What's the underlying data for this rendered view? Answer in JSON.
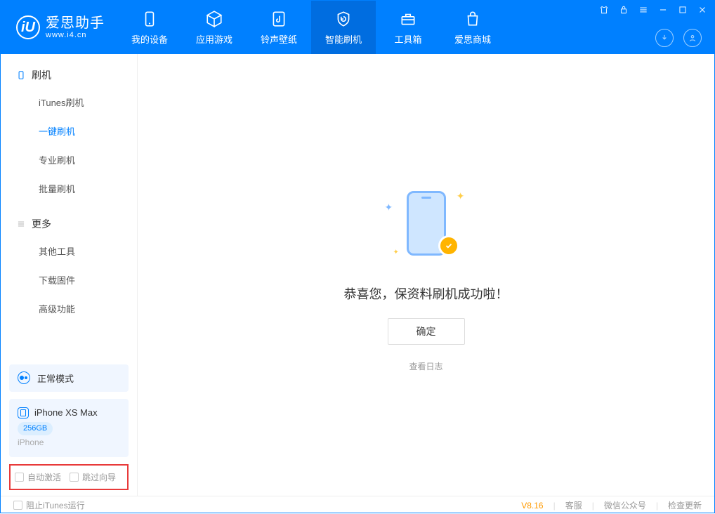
{
  "app": {
    "name": "爱思助手",
    "url": "www.i4.cn"
  },
  "nav": {
    "my_device": "我的设备",
    "apps_games": "应用游戏",
    "ring_wall": "铃声壁纸",
    "smart_flash": "智能刷机",
    "toolbox": "工具箱",
    "store": "爱思商城"
  },
  "sidebar": {
    "flash_head": "刷机",
    "items": {
      "itunes": "iTunes刷机",
      "oneclick": "一键刷机",
      "pro": "专业刷机",
      "batch": "批量刷机"
    },
    "more_head": "更多",
    "more": {
      "other": "其他工具",
      "firmware": "下载固件",
      "advanced": "高级功能"
    }
  },
  "mode": {
    "label": "正常模式"
  },
  "device": {
    "name": "iPhone XS Max",
    "storage": "256GB",
    "type": "iPhone"
  },
  "options": {
    "auto_activate": "自动激活",
    "skip_wizard": "跳过向导"
  },
  "main": {
    "success": "恭喜您，保资料刷机成功啦！",
    "ok": "确定",
    "view_log": "查看日志"
  },
  "footer": {
    "block_itunes": "阻止iTunes运行",
    "version": "V8.16",
    "support": "客服",
    "wechat": "微信公众号",
    "update": "检查更新"
  }
}
